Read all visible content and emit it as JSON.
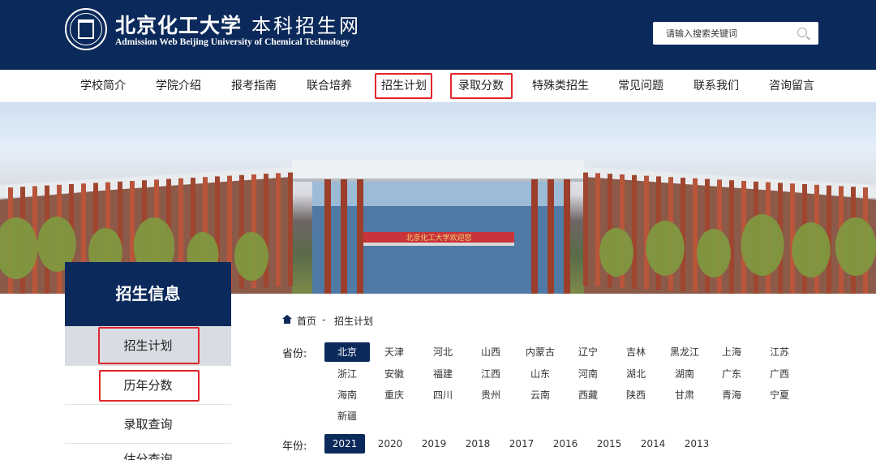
{
  "header": {
    "brand_cn": "北京化工大学",
    "site_name": "本科招生网",
    "brand_en": "Admission Web Beijing University of Chemical Technology",
    "search_placeholder": "请输入搜索关键词"
  },
  "nav": {
    "items": [
      "学校简介",
      "学院介绍",
      "报考指南",
      "联合培养",
      "招生计划",
      "录取分数",
      "特殊类招生",
      "常见问题",
      "联系我们",
      "咨询留言"
    ]
  },
  "banner": {
    "sign_text": "北京化工大学欢迎您"
  },
  "sidebar": {
    "title": "招生信息",
    "items": [
      "招生计划",
      "历年分数",
      "录取查询",
      "估分查询"
    ]
  },
  "breadcrumb": {
    "home": "首页",
    "separator": "-",
    "current": "招生计划"
  },
  "filters": {
    "province_label": "省份:",
    "provinces": [
      "北京",
      "天津",
      "河北",
      "山西",
      "内蒙古",
      "辽宁",
      "吉林",
      "黑龙江",
      "上海",
      "江苏",
      "浙江",
      "安徽",
      "福建",
      "江西",
      "山东",
      "河南",
      "湖北",
      "湖南",
      "广东",
      "广西",
      "海南",
      "重庆",
      "四川",
      "贵州",
      "云南",
      "西藏",
      "陕西",
      "甘肃",
      "青海",
      "宁夏",
      "新疆"
    ],
    "selected_province": "北京",
    "year_label": "年份:",
    "years": [
      "2021",
      "2020",
      "2019",
      "2018",
      "2017",
      "2016",
      "2015",
      "2014",
      "2013"
    ],
    "selected_year": "2021"
  },
  "colors": {
    "navy": "#0b2a5b",
    "highlight_red": "#e0262b"
  }
}
